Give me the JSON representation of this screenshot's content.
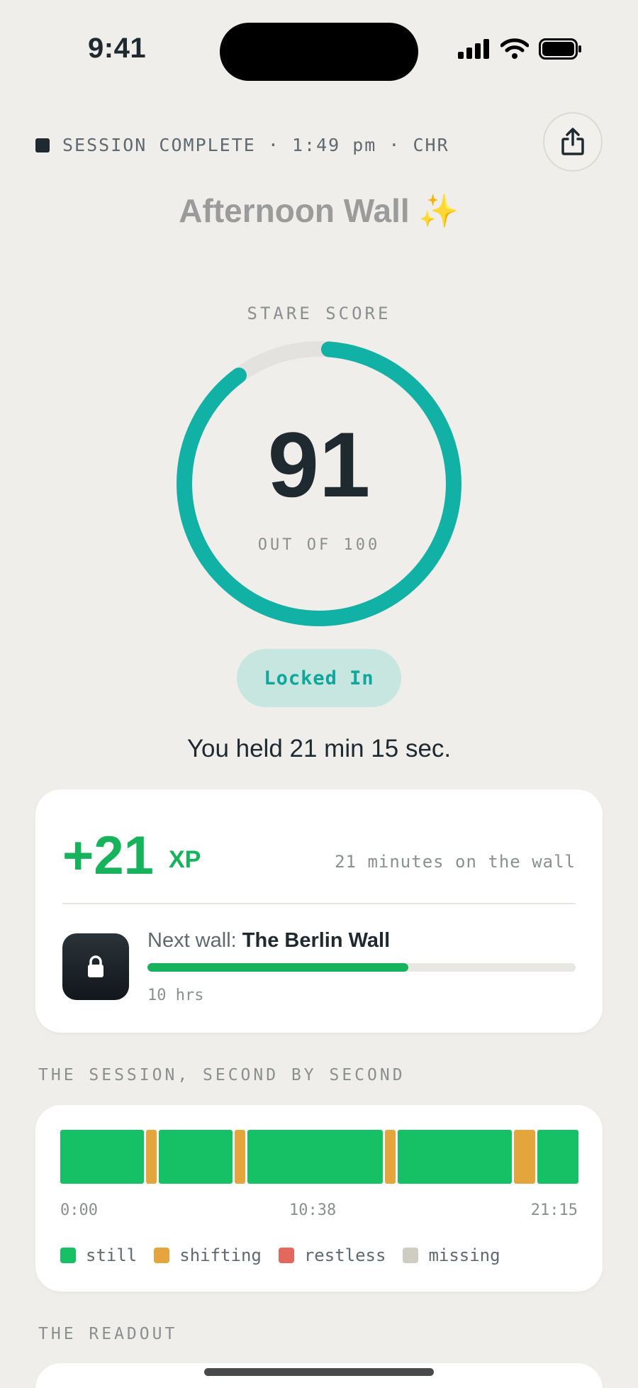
{
  "status_bar": {
    "time": "9:41"
  },
  "header": {
    "session_label": "SESSION COMPLETE · 1:49 pm · CHR",
    "title": "Afternoon Wall ✨"
  },
  "score": {
    "label": "STARE SCORE",
    "value": "91",
    "value_num": 91,
    "max": 100,
    "out_of": "OUT OF 100",
    "badge": "Locked In",
    "held_text": "You held 21 min 15 sec."
  },
  "xp": {
    "amount": "+21",
    "unit": "XP",
    "note": "21 minutes on the wall",
    "next_prefix": "Next wall: ",
    "next_name": "The Berlin Wall",
    "progress": 0.61,
    "goal": "10 hrs"
  },
  "session": {
    "label": "THE SESSION, SECOND BY SECOND",
    "segments": [
      {
        "state": "still",
        "weight": 96
      },
      {
        "state": "shifting",
        "weight": 12
      },
      {
        "state": "still",
        "weight": 84
      },
      {
        "state": "shifting",
        "weight": 12
      },
      {
        "state": "still",
        "weight": 155
      },
      {
        "state": "shifting",
        "weight": 12
      },
      {
        "state": "still",
        "weight": 131
      },
      {
        "state": "shifting",
        "weight": 24
      },
      {
        "state": "still",
        "weight": 47
      }
    ],
    "ticks": [
      "0:00",
      "10:38",
      "21:15"
    ],
    "legend": [
      {
        "key": "still",
        "label": "still",
        "color": "#16c064"
      },
      {
        "key": "shifting",
        "label": "shifting",
        "color": "#e4a63c"
      },
      {
        "key": "restless",
        "label": "restless",
        "color": "#e3695f"
      },
      {
        "key": "missing",
        "label": "missing",
        "color": "#cfcdc2"
      }
    ]
  },
  "readout": {
    "label": "THE READOUT"
  },
  "colors": {
    "accent": "#12b1a5",
    "ring_track": "#e3e2df",
    "xp_green": "#16b35c"
  }
}
